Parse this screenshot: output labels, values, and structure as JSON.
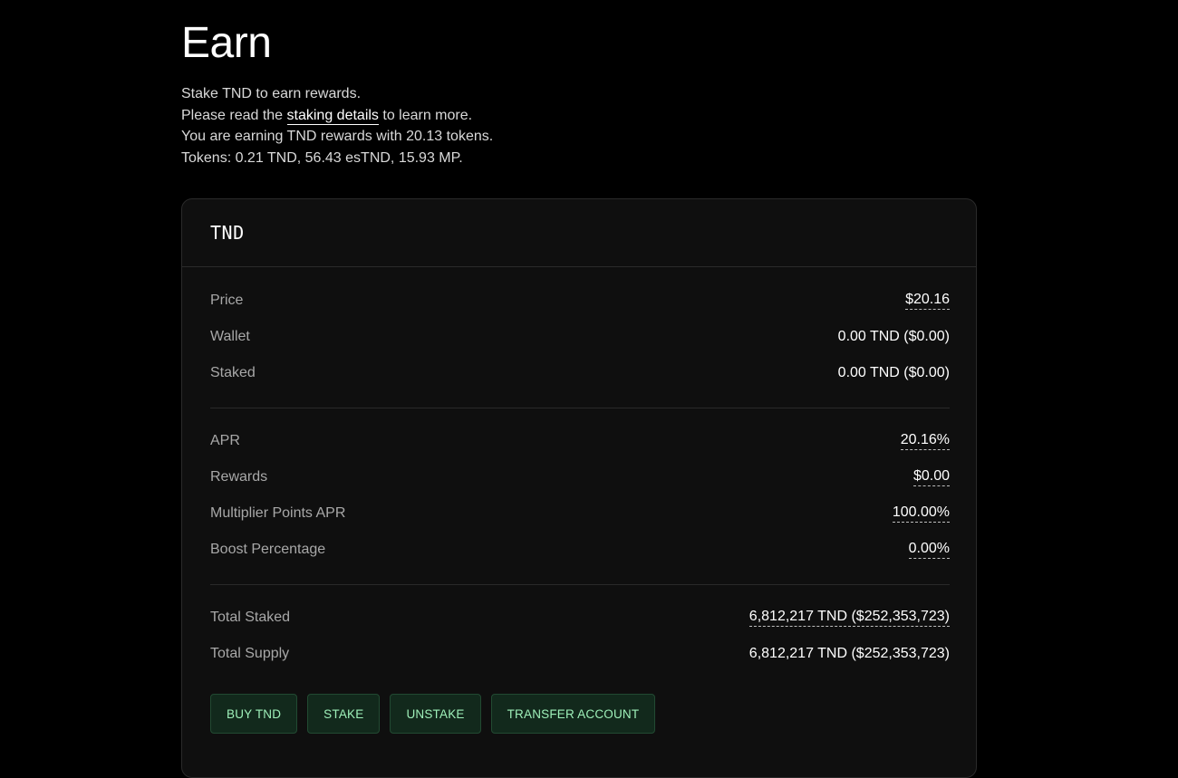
{
  "header": {
    "title": "Earn"
  },
  "intro": {
    "line1": "Stake TND to earn rewards.",
    "line2_prefix": "Please read the ",
    "line2_link": "staking details",
    "line2_suffix": " to learn more.",
    "line3": "You are earning TND rewards with 20.13 tokens.",
    "line4": "Tokens: 0.21 TND, 56.43 esTND, 15.93 MP."
  },
  "card": {
    "title": "TND",
    "section1": [
      {
        "label": "Price",
        "value": "$20.16"
      },
      {
        "label": "Wallet",
        "value": "0.00 TND ($0.00)"
      },
      {
        "label": "Staked",
        "value": "0.00 TND ($0.00)"
      }
    ],
    "section2": [
      {
        "label": "APR",
        "value": "20.16%"
      },
      {
        "label": "Rewards",
        "value": "$0.00"
      },
      {
        "label": "Multiplier Points APR",
        "value": "100.00%"
      },
      {
        "label": "Boost Percentage",
        "value": "0.00%"
      }
    ],
    "section3": [
      {
        "label": "Total Staked",
        "value": "6,812,217 TND ($252,353,723)"
      },
      {
        "label": "Total Supply",
        "value": "6,812,217 TND ($252,353,723)"
      }
    ],
    "buttons": {
      "buy": "BUY TND",
      "stake": "STAKE",
      "unstake": "UNSTAKE",
      "transfer": "TRANSFER ACCOUNT"
    }
  },
  "colors": {
    "background": "#000000",
    "card": "#0f0f0f",
    "button_bg": "#12291c",
    "button_text": "#9ef0b9",
    "label": "#a8a8a8"
  }
}
